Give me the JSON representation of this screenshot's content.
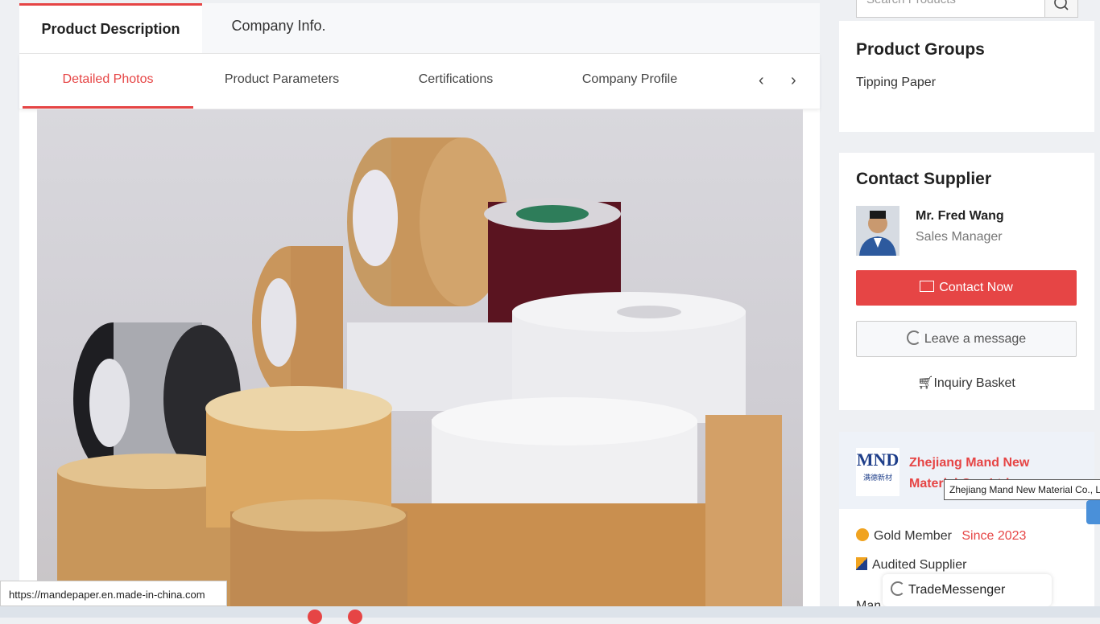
{
  "tabs": {
    "product_description": "Product Description",
    "company_info": "Company Info."
  },
  "subnav": {
    "items": [
      "Detailed Photos",
      "Product Parameters",
      "Certifications",
      "Company Profile"
    ],
    "prev": "‹",
    "next": "›"
  },
  "sidebar": {
    "search_placeholder": "Search Products",
    "product_groups": {
      "title": "Product Groups",
      "items": [
        "Tipping Paper"
      ]
    },
    "contact": {
      "title": "Contact Supplier",
      "name": "Mr. Fred Wang",
      "role": "Sales Manager",
      "contact_now": "Contact Now",
      "leave_message": "Leave a message",
      "inquiry_basket": "Inquiry Basket"
    },
    "company": {
      "name": "Zhejiang Mand New Material Co., Ltd.",
      "logo_text": "MND",
      "logo_sub": "满德新材",
      "gold_member": "Gold Member",
      "since": "Since 2023",
      "audited": "Audited Supplier",
      "more": "Man"
    }
  },
  "tooltip": "Zhejiang Mand New Material Co., Ltd.",
  "status_url": "https://mandepaper.en.made-in-china.com",
  "trade_messenger": "TradeMessenger",
  "colors": {
    "accent": "#e64545"
  }
}
